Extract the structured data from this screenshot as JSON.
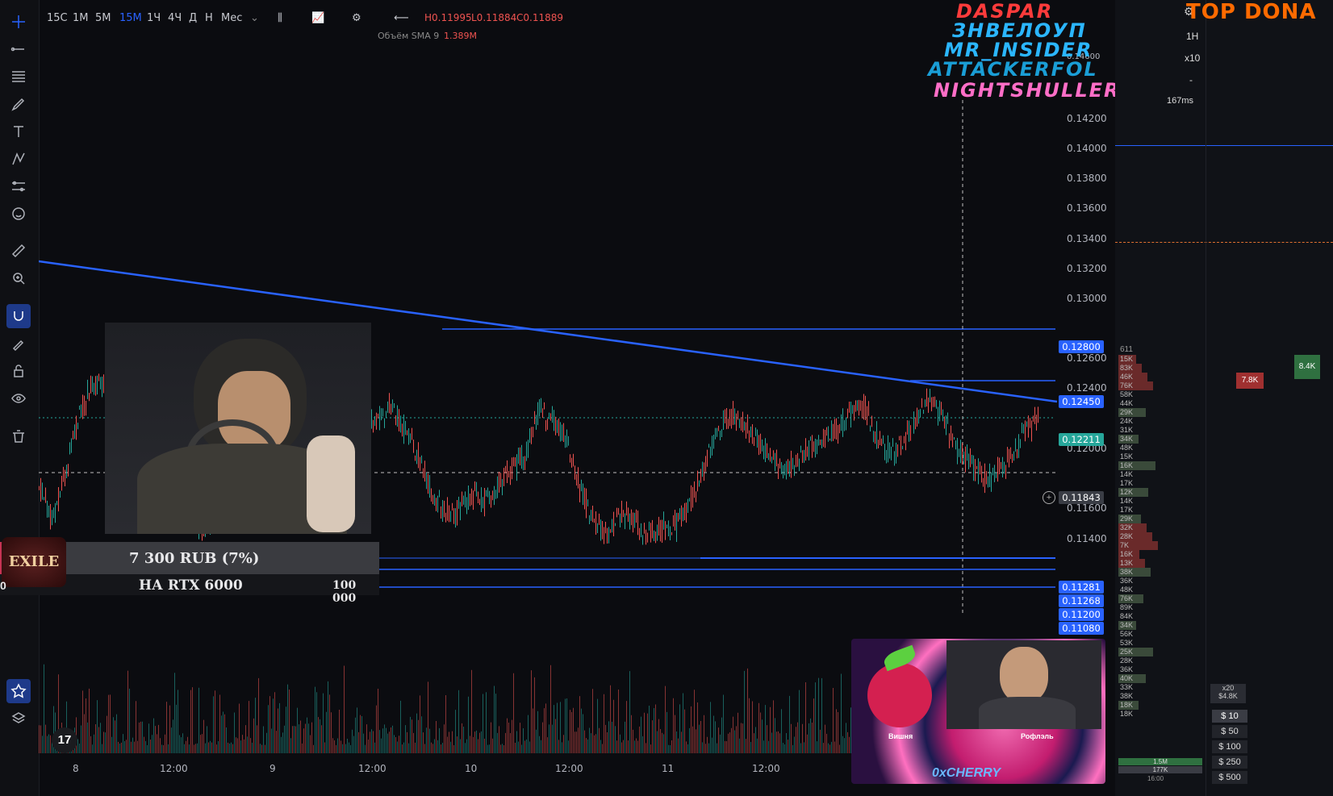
{
  "toolbar": {
    "timeframes": [
      "15С",
      "1М",
      "5М",
      "15М",
      "1Ч",
      "4Ч",
      "Д",
      "Н",
      "Мес"
    ],
    "active_timeframe": "15М",
    "ohlc": {
      "h": "H0.11995",
      "l": "L0.11884",
      "c": "C0.11889"
    },
    "volume_label": "Объём SMA 9",
    "volume_value": "1.389M"
  },
  "price_axis": {
    "ticks": [
      "0.14200",
      "0.14000",
      "0.13800",
      "0.13600",
      "0.13400",
      "0.13200",
      "0.13000",
      "0.12600",
      "0.12400",
      "0.12000",
      "0.11600",
      "0.11400"
    ],
    "top_ticks": [
      "0.14600"
    ],
    "badges": {
      "b12800": "0.12800",
      "b12450": "0.12450",
      "b12211": "0.12211",
      "b11843": "0.11843",
      "b11281": "0.11281",
      "b11268": "0.11268",
      "b11200": "0.11200",
      "b11080": "0.11080"
    }
  },
  "time_axis": [
    "8",
    "12:00",
    "9",
    "12:00",
    "10",
    "12:00",
    "11",
    "12:00"
  ],
  "overlays": {
    "names": [
      "DASPAR",
      "ЗНВЕЛОУП",
      "MR_INSIDER",
      "ATTACKERFOL",
      "NIGHTSHULLER"
    ],
    "top_donat": "TOP DONA",
    "donation_amount": "7 300 RUB (7%)",
    "donation_goal": "НА RTX 6000",
    "donation_target": "100 000",
    "donation_zero": "0",
    "game_logo": "EXILE",
    "cherry_brand": "0xCHERRY",
    "cherry_left_name": "Вишня",
    "cherry_right_name": "Рофлэль"
  },
  "right_panel": {
    "interval": "1H",
    "mult": "x10",
    "dash": "-",
    "latency": "167ms",
    "val_611": "611",
    "vals": [
      "15K",
      "83K",
      "46K",
      "76K",
      "58K",
      "44K",
      "29K",
      "24K",
      "31K",
      "34K",
      "48K",
      "15K",
      "16K",
      "14K",
      "17K",
      "12K",
      "14K",
      "17K",
      "29K",
      "32K",
      "28K",
      "7K",
      "16K",
      "13K",
      "38K",
      "36K",
      "48K",
      "76K",
      "89K",
      "84K",
      "34K",
      "56K",
      "53K",
      "25K",
      "28K",
      "36K",
      "40K",
      "33K",
      "38K",
      "18K",
      "18K"
    ],
    "bubble_a": "7.8K",
    "bubble_b": "8.4K",
    "x20": "x20",
    "x20_val": "$4.8K",
    "amounts": [
      "$ 10",
      "$ 50",
      "$ 100",
      "$ 250",
      "$ 500"
    ],
    "bottom_vols": [
      "1.5M",
      "177K",
      "16:00"
    ]
  },
  "tv_logo": "17",
  "colors": {
    "up": "#26a69a",
    "down": "#ef5350",
    "line": "#2962ff",
    "bg": "#0b0c10"
  }
}
